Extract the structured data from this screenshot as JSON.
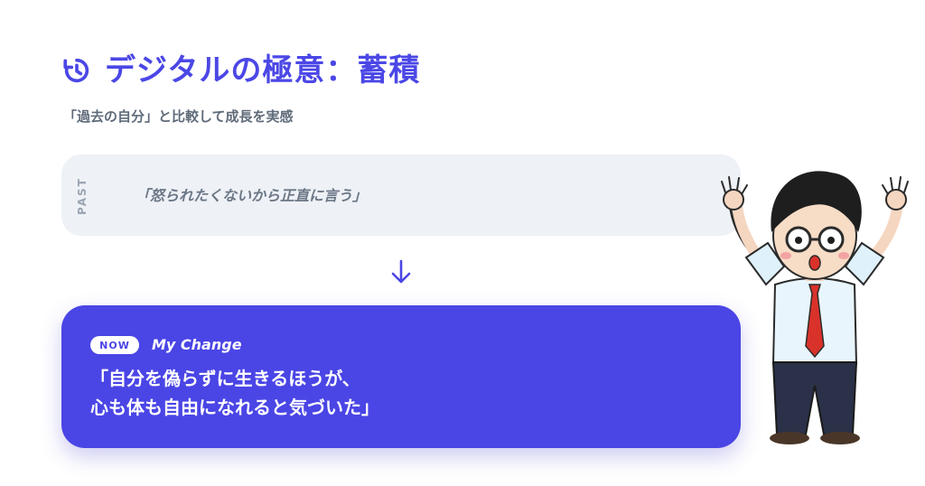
{
  "header": {
    "title": "デジタルの極意：蓄積",
    "subtitle": "「過去の自分」と比較して成長を実感",
    "icon": "history-icon"
  },
  "past": {
    "tag": "PAST",
    "quote": "「怒られたくないから正直に言う」"
  },
  "arrow": {
    "icon": "arrow-down-icon"
  },
  "now": {
    "badge": "NOW",
    "label": "My Change",
    "line1": "「自分を偽らずに生きるほうが、",
    "line2": "心も体も自由になれると気づいた」"
  },
  "colors": {
    "accent": "#4a45e5",
    "past_bg": "#eef1f6",
    "muted_text": "#6b7786"
  }
}
